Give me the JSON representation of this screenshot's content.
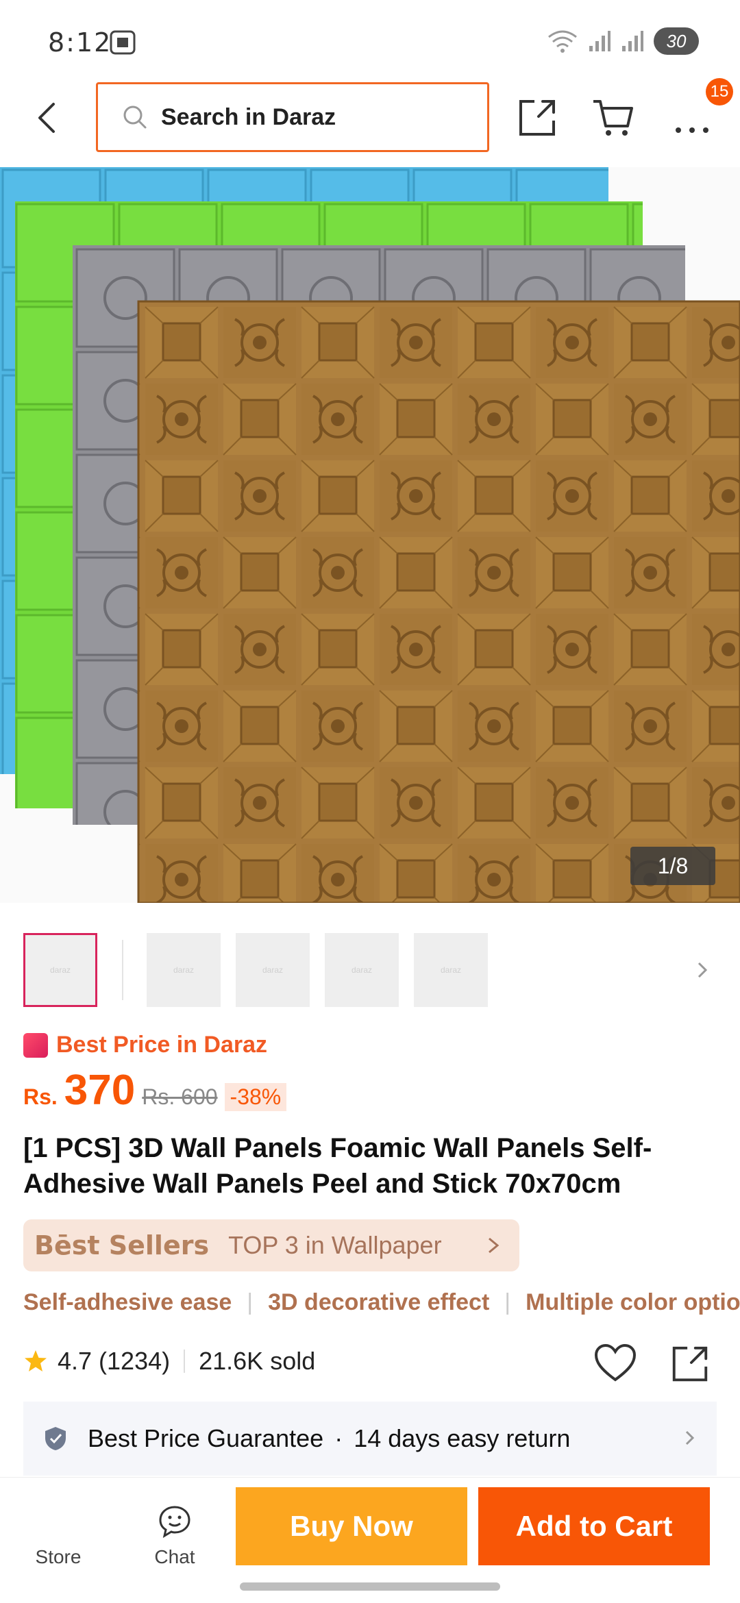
{
  "status_bar": {
    "time": "8:12",
    "battery": "30"
  },
  "nav": {
    "search_placeholder": "Search in Daraz",
    "cart_count": "15"
  },
  "hero": {
    "counter": "1/8"
  },
  "thumbs": {
    "label": "daraz"
  },
  "price": {
    "badge": "Best Price in Daraz",
    "currency": "Rs.",
    "current": "370",
    "original": "Rs. 600",
    "discount": "-38%"
  },
  "product": {
    "title": "[1 PCS] 3D Wall Panels Foamic Wall Panels Self-Adhesive Wall Panels Peel and Stick 70x70cm"
  },
  "best_sellers": {
    "label": "Bēst Sellers",
    "rank": "TOP 3 in Wallpaper"
  },
  "features": [
    "Self-adhesive ease",
    "3D decorative effect",
    "Multiple color options"
  ],
  "rating": {
    "score": "4.7 (1234)",
    "sold": "21.6K sold"
  },
  "guarantee": {
    "text": "Best Price Guarantee",
    "dot": "·",
    "returns": "14 days easy return"
  },
  "bottom_bar": {
    "store": "Store",
    "chat": "Chat",
    "buy_now": "Buy Now",
    "add_to_cart": "Add to Cart"
  },
  "colors": {
    "accent": "#f85606",
    "buy": "#fca61f",
    "panel_brown": "#a87a3c",
    "panel_gray": "#8e8e94",
    "panel_green": "#72d83a",
    "panel_blue": "#4fb6e2"
  }
}
